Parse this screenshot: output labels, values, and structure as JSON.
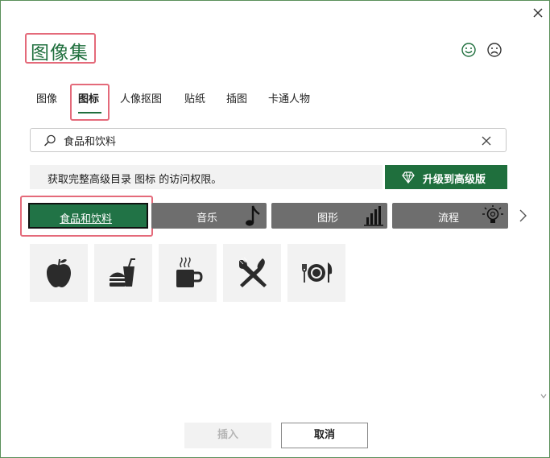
{
  "dialog": {
    "title": "图像集",
    "colors": {
      "accent": "#1f6f3d",
      "highlight": "#e46a7a",
      "category_bg": "#6e6e6e",
      "active_category": "#217346"
    }
  },
  "tabs": [
    {
      "label": "图像"
    },
    {
      "label": "图标"
    },
    {
      "label": "人像抠图"
    },
    {
      "label": "贴纸"
    },
    {
      "label": "插图"
    },
    {
      "label": "卡通人物"
    }
  ],
  "active_tab": "图标",
  "search": {
    "value": "食品和饮料",
    "icon": "search-icon"
  },
  "banner": {
    "text": "获取完整高级目录 图标 的访问权限。"
  },
  "upgrade": {
    "label": "升级到高级版",
    "icon": "diamond-icon"
  },
  "categories": [
    {
      "label": "食品和饮料",
      "icon": ""
    },
    {
      "label": "音乐",
      "icon": "music-note-icon"
    },
    {
      "label": "图形",
      "icon": "bar-chart-icon"
    },
    {
      "label": "流程",
      "icon": "lightbulb-icon"
    }
  ],
  "results": [
    {
      "icon": "apple-icon"
    },
    {
      "icon": "fast-food-icon"
    },
    {
      "icon": "coffee-cup-icon"
    },
    {
      "icon": "fork-knife-icon"
    },
    {
      "icon": "plate-cutlery-icon"
    }
  ],
  "footer": {
    "insert_label": "插入",
    "cancel_label": "取消"
  }
}
